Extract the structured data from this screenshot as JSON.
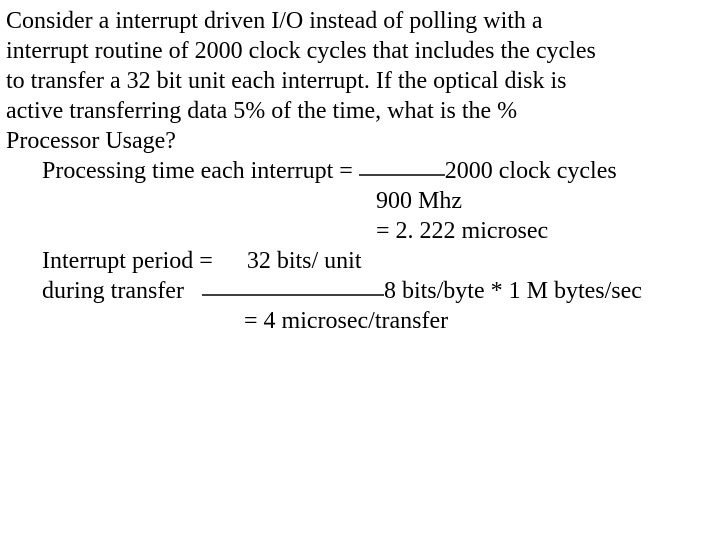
{
  "line1": "Consider a interrupt driven I/O instead of polling with a",
  "line2": "interrupt routine of 2000 clock cycles that includes the cycles",
  "line3": "to transfer a 32 bit unit each interrupt.  If the optical disk is",
  "line4": "active transferring data 5% of the time, what is the %",
  "line5": "Processor Usage?",
  "calc": {
    "proc_time_label": "Processing time each interrupt = ",
    "proc_time_num": "2000 clock cycles",
    "proc_time_den": "900 Mhz",
    "proc_time_result": "= 2. 222 microsec",
    "int_period_label1": "Interrupt period = ",
    "int_period_num": "32 bits/ unit",
    "int_period_label2": "during transfer",
    "int_period_den": "8 bits/byte * 1 M bytes/sec",
    "int_period_result": "= 4 microsec/transfer"
  }
}
